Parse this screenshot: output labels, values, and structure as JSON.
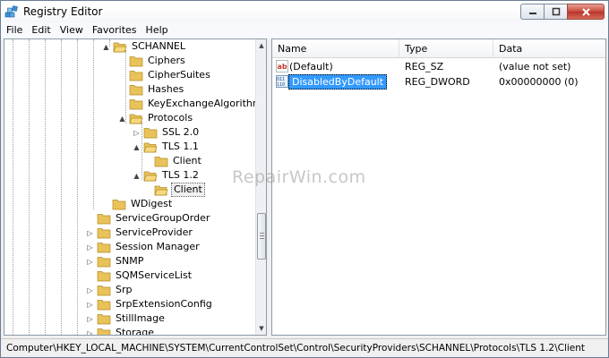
{
  "window": {
    "title": "Registry Editor"
  },
  "menu": [
    "File",
    "Edit",
    "View",
    "Favorites",
    "Help"
  ],
  "tree": [
    {
      "label": "SCHANNEL",
      "expander": "▲",
      "selected": false
    },
    {
      "label": "Ciphers",
      "expander": "",
      "selected": false
    },
    {
      "label": "CipherSuites",
      "expander": "",
      "selected": false
    },
    {
      "label": "Hashes",
      "expander": "",
      "selected": false
    },
    {
      "label": "KeyExchangeAlgorithms",
      "expander": "",
      "selected": false
    },
    {
      "label": "Protocols",
      "expander": "▲",
      "selected": false
    },
    {
      "label": "SSL 2.0",
      "expander": "▷",
      "selected": false
    },
    {
      "label": "TLS 1.1",
      "expander": "▲",
      "selected": false
    },
    {
      "label": "Client",
      "expander": "",
      "selected": false
    },
    {
      "label": "TLS 1.2",
      "expander": "▲",
      "selected": false
    },
    {
      "label": "Client",
      "expander": "",
      "selected": true
    },
    {
      "label": "WDigest",
      "expander": "",
      "selected": false
    },
    {
      "label": "ServiceGroupOrder",
      "expander": "",
      "selected": false
    },
    {
      "label": "ServiceProvider",
      "expander": "▷",
      "selected": false
    },
    {
      "label": "Session Manager",
      "expander": "▷",
      "selected": false
    },
    {
      "label": "SNMP",
      "expander": "▷",
      "selected": false
    },
    {
      "label": "SQMServiceList",
      "expander": "",
      "selected": false
    },
    {
      "label": "Srp",
      "expander": "▷",
      "selected": false
    },
    {
      "label": "SrpExtensionConfig",
      "expander": "▷",
      "selected": false
    },
    {
      "label": "StillImage",
      "expander": "▷",
      "selected": false
    },
    {
      "label": "Storage",
      "expander": "▷",
      "selected": false
    }
  ],
  "list": {
    "columns": [
      "Name",
      "Type",
      "Data"
    ],
    "rows": [
      {
        "icon": "ab",
        "name": "(Default)",
        "type": "REG_SZ",
        "data": "(value not set)",
        "selected": false
      },
      {
        "icon": "dword",
        "name": "DisabledByDefault",
        "type": "REG_DWORD",
        "data": "0x00000000 (0)",
        "selected": true
      }
    ]
  },
  "watermark": "RepairWin.com",
  "status": "Computer\\HKEY_LOCAL_MACHINE\\SYSTEM\\CurrentControlSet\\Control\\SecurityProviders\\SCHANNEL\\Protocols\\TLS 1.2\\Client",
  "colors": {
    "folder": "#e9c35a",
    "selection": "#3399ff",
    "close": "#c8473a"
  }
}
